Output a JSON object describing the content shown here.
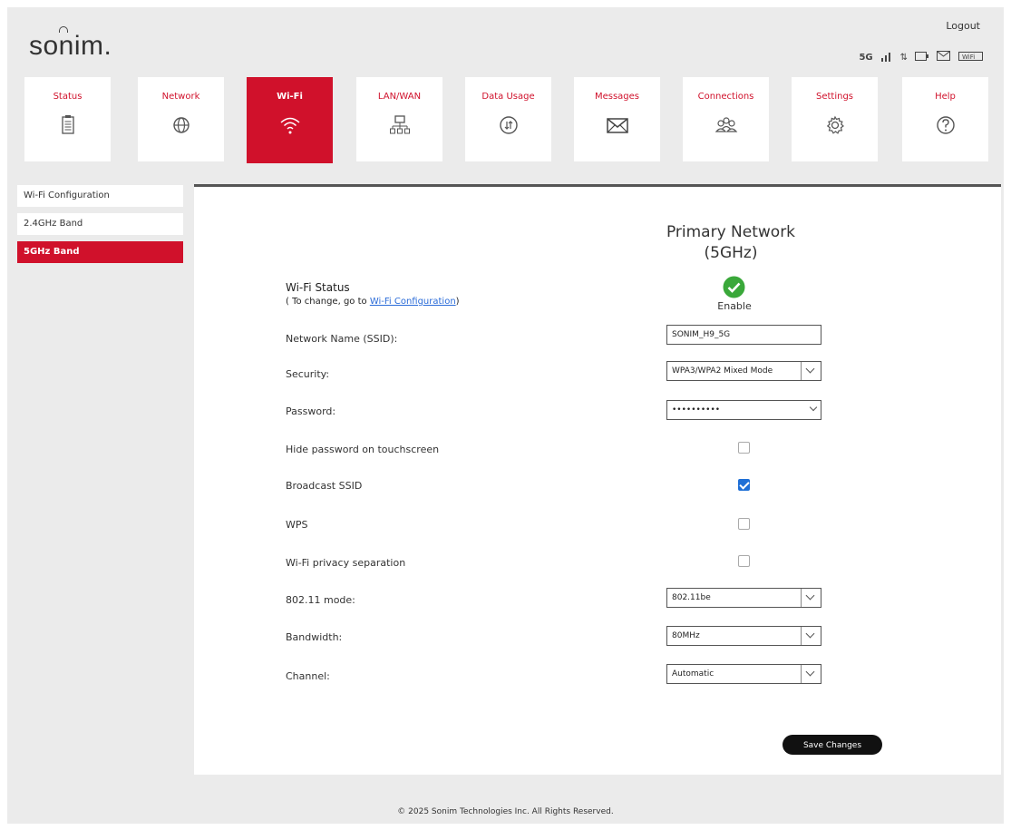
{
  "header": {
    "logo": "sonim.",
    "logout": "Logout",
    "status_icons": [
      "5G",
      "signal",
      "⇅",
      "battery",
      "msg",
      "WiFi"
    ]
  },
  "tabs": [
    {
      "label": "Status",
      "icon": "clipboard-icon"
    },
    {
      "label": "Network",
      "icon": "globe-icon"
    },
    {
      "label": "Wi-Fi",
      "icon": "wifi-icon",
      "active": true
    },
    {
      "label": "LAN/WAN",
      "icon": "network-tree-icon"
    },
    {
      "label": "Data Usage",
      "icon": "data-usage-icon"
    },
    {
      "label": "Messages",
      "icon": "envelope-icon"
    },
    {
      "label": "Connections",
      "icon": "users-icon"
    },
    {
      "label": "Settings",
      "icon": "gear-icon"
    },
    {
      "label": "Help",
      "icon": "help-icon"
    }
  ],
  "sidebar": {
    "items": [
      {
        "label": "Wi-Fi Configuration"
      },
      {
        "label": "2.4GHz Band"
      },
      {
        "label": "5GHz Band",
        "active": true
      }
    ]
  },
  "main": {
    "title_line1": "Primary Network",
    "title_line2": "(5GHz)",
    "wifi_status_label": "Wi-Fi Status",
    "wifi_status_note_prefix": "( To change, go to ",
    "wifi_status_link": "Wi-Fi Configuration",
    "wifi_status_note_suffix": ")",
    "wifi_status_value": "Enable",
    "ssid_label": "Network Name (SSID):",
    "ssid_value": "SONIM_H9_5G",
    "security_label": "Security:",
    "security_value": "WPA3/WPA2 Mixed Mode",
    "password_label": "Password:",
    "password_value": "••••••••••",
    "hide_password_label": "Hide password on touchscreen",
    "hide_password_checked": false,
    "broadcast_label": "Broadcast SSID",
    "broadcast_checked": true,
    "wps_label": "WPS",
    "wps_checked": false,
    "privacy_label": "Wi-Fi privacy separation",
    "privacy_checked": false,
    "mode_label": "802.11 mode:",
    "mode_value": "802.11be",
    "bandwidth_label": "Bandwidth:",
    "bandwidth_value": "80MHz",
    "channel_label": "Channel:",
    "channel_value": "Automatic",
    "save_label": "Save Changes"
  },
  "footer": {
    "text": "© 2025 Sonim Technologies Inc. All Rights Reserved."
  },
  "colors": {
    "accent": "#d0112b",
    "check_blue": "#1f6fd6",
    "enable_green": "#3aa83a"
  }
}
